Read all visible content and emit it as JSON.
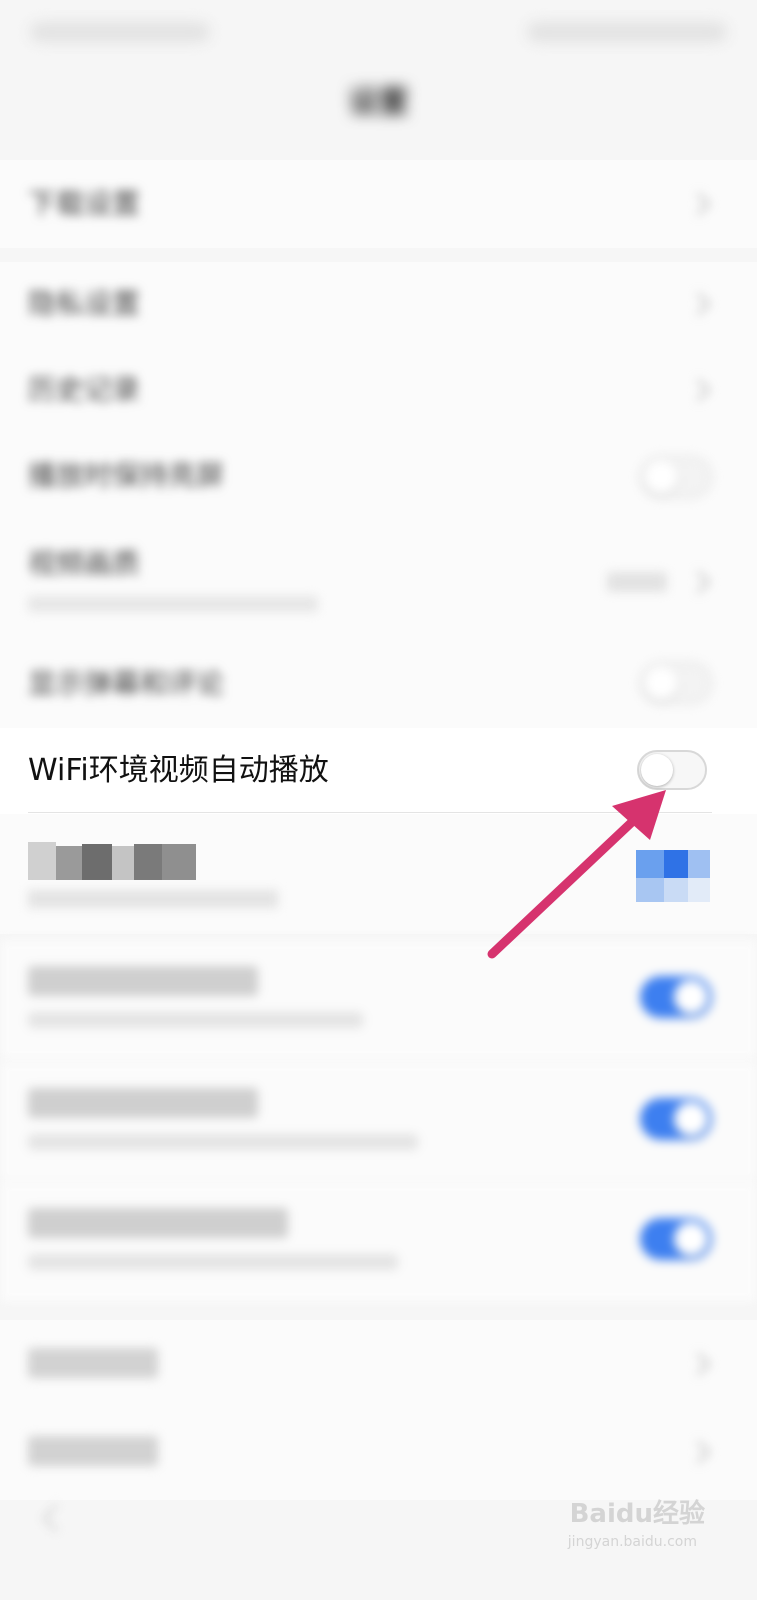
{
  "title": "设置",
  "sections": [
    {
      "rows": [
        {
          "label": "下载设置",
          "type": "chevron"
        }
      ]
    },
    {
      "rows": [
        {
          "label": "隐私设置",
          "type": "chevron"
        },
        {
          "label": "历史记录",
          "type": "chevron"
        },
        {
          "label": "播放时保持亮屏",
          "type": "toggle",
          "on": false
        },
        {
          "label": "视频画质",
          "sub": "",
          "value": "",
          "type": "chevron"
        },
        {
          "label": "显示弹幕和评论",
          "type": "toggle",
          "on": false
        }
      ]
    }
  ],
  "wifi_autoplay": {
    "label": "WiFi环境视频自动播放",
    "on": false
  },
  "rows_after": [
    {
      "label": "",
      "sub": "",
      "type": "toggle",
      "on": true
    },
    {
      "label": "",
      "sub": "",
      "type": "toggle",
      "on": true
    },
    {
      "label": "",
      "sub": "",
      "type": "toggle",
      "on": true
    },
    {
      "label": "",
      "sub": "",
      "type": "toggle",
      "on": true
    }
  ],
  "bottom_rows": [
    {
      "label": "",
      "type": "chevron"
    },
    {
      "label": "",
      "type": "chevron"
    }
  ],
  "watermark": {
    "text": "Baidu经验",
    "sub": "jingyan.baidu.com"
  },
  "colors": {
    "accent": "#3d7ff0",
    "arrow": "#d6336e",
    "background": "#f6f6f6"
  }
}
